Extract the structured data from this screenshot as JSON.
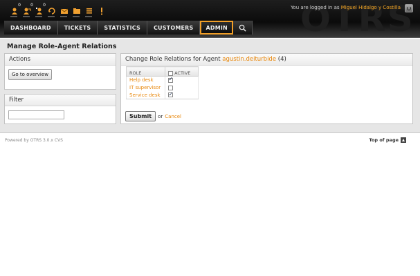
{
  "toolbar": {
    "items": [
      {
        "icon": "locked-tickets-icon",
        "count": "0"
      },
      {
        "icon": "watched-tickets-icon",
        "count": "0"
      },
      {
        "icon": "responsible-tickets-icon",
        "count": "0"
      },
      {
        "icon": "escalation-icon",
        "count": ""
      },
      {
        "icon": "new-email-ticket-icon",
        "count": ""
      },
      {
        "icon": "new-phone-ticket-icon",
        "count": ""
      },
      {
        "icon": "queue-view-icon",
        "count": ""
      },
      {
        "icon": "status-view-icon",
        "count": ""
      }
    ]
  },
  "header": {
    "watermark": "OTRS",
    "logged_in_prefix": "You are logged in as",
    "user_name": "Miguel Hidalgo y Costilla"
  },
  "nav": {
    "items": [
      "DASHBOARD",
      "TICKETS",
      "STATISTICS",
      "CUSTOMERS",
      "ADMIN"
    ],
    "selected": "ADMIN"
  },
  "page": {
    "title": "Manage Role-Agent Relations"
  },
  "actions": {
    "heading": "Actions",
    "overview_button": "Go to overview"
  },
  "filter": {
    "heading": "Filter",
    "value": ""
  },
  "relations": {
    "heading_prefix": "Change Role Relations for Agent",
    "agent_login": "agustin.deiturbide",
    "agent_id": "(4)",
    "col_role": "ROLE",
    "col_active": "ACTIVE",
    "rows": [
      {
        "role": "Help desk",
        "active": true
      },
      {
        "role": "IT supervisor",
        "active": false
      },
      {
        "role": "Service desk",
        "active": true
      }
    ],
    "submit_label": "Submit",
    "or_text": "or",
    "cancel_label": "Cancel"
  },
  "footer": {
    "powered_by": "Powered by OTRS 3.0.x CVS",
    "top_of_page": "Top of page"
  },
  "colors": {
    "accent": "#e8870b",
    "nav_selected_border": "#f29f27"
  }
}
